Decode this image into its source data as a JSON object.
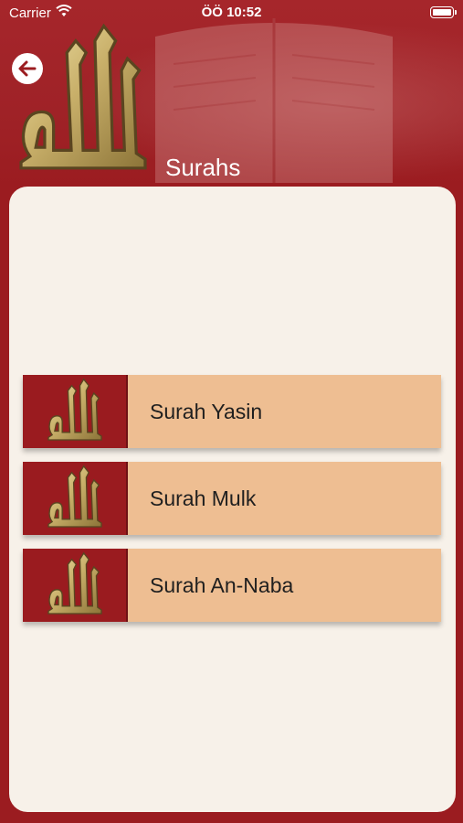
{
  "status_bar": {
    "carrier": "Carrier",
    "time": "ÖÖ 10:52"
  },
  "header": {
    "title": "Surahs",
    "back_icon": "arrow-left-icon"
  },
  "surahs": [
    {
      "label": "Surah Yasin"
    },
    {
      "label": "Surah Mulk"
    },
    {
      "label": "Surah An-Naba"
    }
  ],
  "colors": {
    "primary": "#9b1c20",
    "card_bg": "#f7f1e9",
    "item_bg": "#eebe92",
    "gold": "#c8b070"
  }
}
